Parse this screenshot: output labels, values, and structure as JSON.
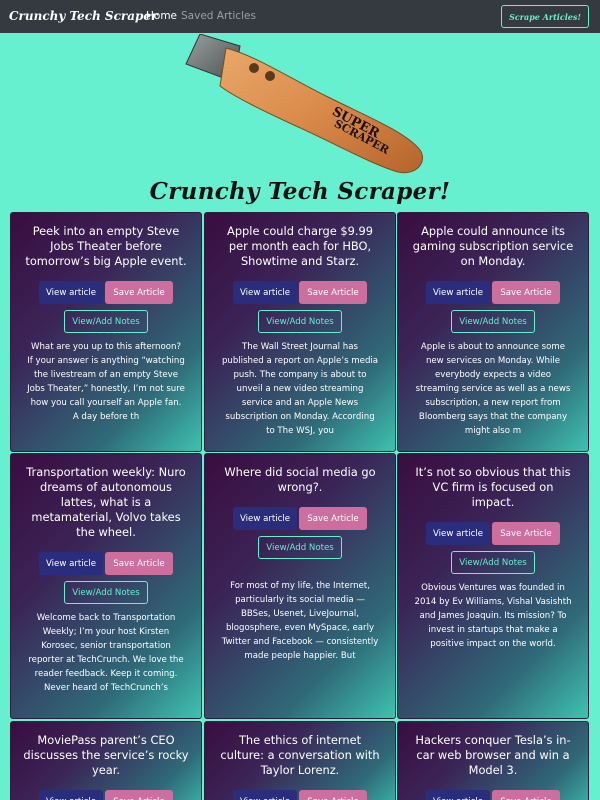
{
  "navbar": {
    "brand": "Crunchy Tech Scraper",
    "home": "Home",
    "saved": "Saved Articles",
    "scrape_button": "Scrape Articles!"
  },
  "hero": {
    "logo_text": "SUPER SCRAPER",
    "title": "Crunchy Tech Scraper!"
  },
  "colors": {
    "background": "#66f0cf",
    "navbar": "#343a40",
    "view_button": "#2a2d7c",
    "save_button": "#cc6f9e",
    "accent": "#66f0cf"
  },
  "buttons": {
    "view": "View article",
    "save": "Save Article",
    "notes": "View/Add Notes"
  },
  "articles": [
    {
      "title": "Peek into an empty Steve Jobs Theater before tomorrow’s big Apple event.",
      "summary": "What are you up to this afternoon? If your answer is anything “watching the livestream of an empty Steve Jobs Theater,” honestly, I’m not sure how you call yourself an Apple fan. A day before th"
    },
    {
      "title": "Apple could charge $9.99 per month each for HBO, Showtime and Starz.",
      "summary": "The Wall Street Journal has published a report on Apple’s media push. The company is about to unveil a new video streaming service and an Apple News subscription on Monday. According to The WSJ, you"
    },
    {
      "title": "Apple could announce its gaming subscription service on Monday.",
      "summary": "Apple is about to announce some new services on Monday. While everybody expects a video streaming service as well as a news subscription, a new report from Bloomberg says that the company might also m"
    },
    {
      "title": "Transportation weekly: Nuro dreams of autonomous lattes, what is a metamaterial, Volvo takes the wheel.",
      "summary": "Welcome back to Transportation Weekly; I’m your host Kirsten Korosec, senior transportation reporter at TechCrunch. We love the reader feedback. Keep it coming. Never heard of TechCrunch’s"
    },
    {
      "title": "Where did social media go wrong?.",
      "summary": "For most of my life, the Internet, particularly its social media — BBSes, Usenet, LiveJournal, blogosphere, even MySpace, early Twitter and Facebook — consistently made people happier. But"
    },
    {
      "title": "It’s not so obvious that this VC firm is focused on impact.",
      "summary": "Obvious Ventures was founded in 2014 by Ev Williams, Vishal Vasishth and James Joaquin. Its mission? To invest in startups that make a positive impact on the world."
    },
    {
      "title": "MoviePass parent’s CEO discusses the service’s rocky year.",
      "summary": ""
    },
    {
      "title": "The ethics of internet culture: a conversation with Taylor Lorenz.",
      "summary": ""
    },
    {
      "title": "Hackers conquer Tesla’s in-car web browser and win a Model 3.",
      "summary": ""
    }
  ]
}
